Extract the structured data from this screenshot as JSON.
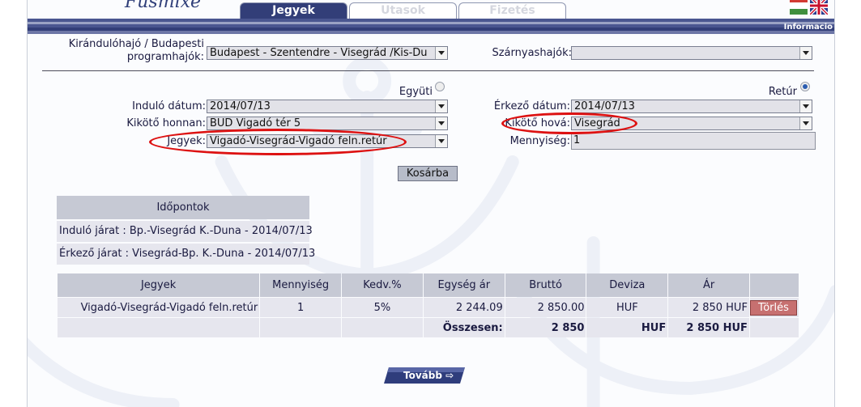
{
  "header": {
    "logo_text": "Füsmixe",
    "tabs": [
      {
        "label": "Jegyek",
        "active": true
      },
      {
        "label": "Utasok",
        "active": false
      },
      {
        "label": "Fizetés",
        "active": false
      }
    ],
    "info_label": "Informacio"
  },
  "form": {
    "programs_label": "Kirándulóhajó / Budapesti programhajók:",
    "programs_value": "Budapest - Szentendre - Visegrád /Kis-Du",
    "hydrofoil_label": "Szárnyashajók:",
    "hydrofoil_value": "",
    "oneway_label": "Együti",
    "return_label": "Retúr",
    "departure_date_label": "Induló dátum:",
    "departure_date_value": "2014/07/13",
    "arrival_date_label": "Érkező dátum:",
    "arrival_date_value": "2014/07/13",
    "port_from_label": "Kikötő honnan:",
    "port_from_value": "BUD Vigadó tér 5",
    "port_to_label": "Kikötő hová:",
    "port_to_value": "Visegrád",
    "tickets_label": "Jegyek:",
    "tickets_value": "Vigadó-Visegrád-Vigadó feln.retúr",
    "quantity_label": "Mennyiség:",
    "quantity_value": "1",
    "add_to_cart_label": "Kosárba"
  },
  "timetable": {
    "title": "Időpontok",
    "departure": "Induló járat : Bp.-Visegrád K.-Duna - 2014/07/13",
    "arrival": "Érkező járat : Visegrád-Bp. K.-Duna - 2014/07/13"
  },
  "cart": {
    "headers": [
      "Jegyek",
      "Mennyiség",
      "Kedv.%",
      "Egység ár",
      "Bruttó",
      "Deviza",
      "Ár"
    ],
    "row": {
      "ticket": "Vigadó-Visegrád-Vigadó feln.retúr",
      "quantity": "1",
      "discount": "5%",
      "unit_price": "2 244.09",
      "gross": "2 850.00",
      "currency": "HUF",
      "price": "2 850 HUF",
      "delete_label": "Törlés"
    },
    "total": {
      "label": "Összesen:",
      "gross": "2 850",
      "currency": "HUF",
      "price": "2 850 HUF"
    }
  },
  "next_button_label": "Tovább",
  "colors": {
    "navy": "#323e78",
    "header_stripe": "#4a5690",
    "cell_header": "#c6c9d4",
    "cell_body": "#e6e6ee",
    "annotation_red": "#dd1111",
    "delete_red": "#c77070"
  }
}
